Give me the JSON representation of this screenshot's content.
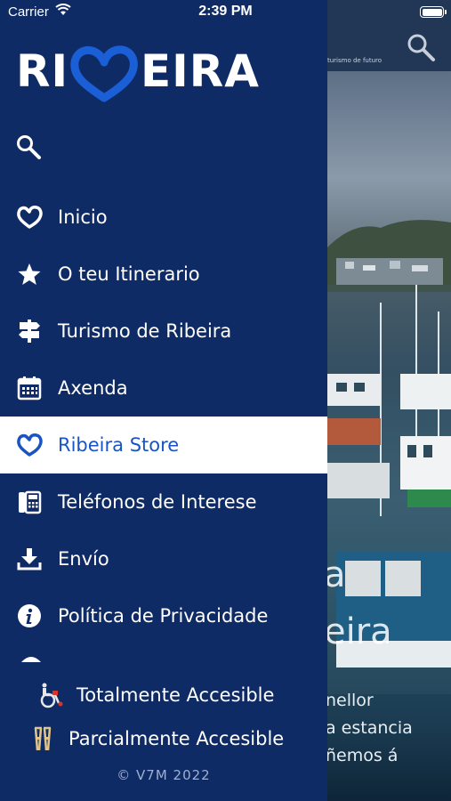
{
  "status_bar": {
    "carrier": "Carrier",
    "time": "2:39 PM"
  },
  "background": {
    "tagline": "turismo de futuro",
    "hero_line1": "a",
    "hero_line2": "eira",
    "paragraph": [
      "nellor",
      "a estancia",
      "ñemos á"
    ]
  },
  "drawer": {
    "logo_left": "RI",
    "logo_right": "EIRA",
    "menu": [
      {
        "label": "Inicio",
        "icon": "heart-icon",
        "active": false
      },
      {
        "label": "O teu Itinerario",
        "icon": "star-icon",
        "active": false
      },
      {
        "label": "Turismo de Ribeira",
        "icon": "signpost-icon",
        "active": false
      },
      {
        "label": "Axenda",
        "icon": "calendar-icon",
        "active": false
      },
      {
        "label": "Ribeira Store",
        "icon": "heart-icon",
        "active": true
      },
      {
        "label": "Teléfonos de Interese",
        "icon": "phone-icon",
        "active": false
      },
      {
        "label": "Envío",
        "icon": "download-icon",
        "active": false
      },
      {
        "label": "Política de Privacidade",
        "icon": "info-icon",
        "active": false
      }
    ],
    "accessibility": {
      "total": "Totalmente Accesible",
      "partial": "Parcialmente Accesible"
    },
    "copyright": "© V7M 2022"
  },
  "colors": {
    "drawer_bg": "#0f2b66",
    "accent": "#1a54c4",
    "active_row_bg": "#ffffff"
  }
}
